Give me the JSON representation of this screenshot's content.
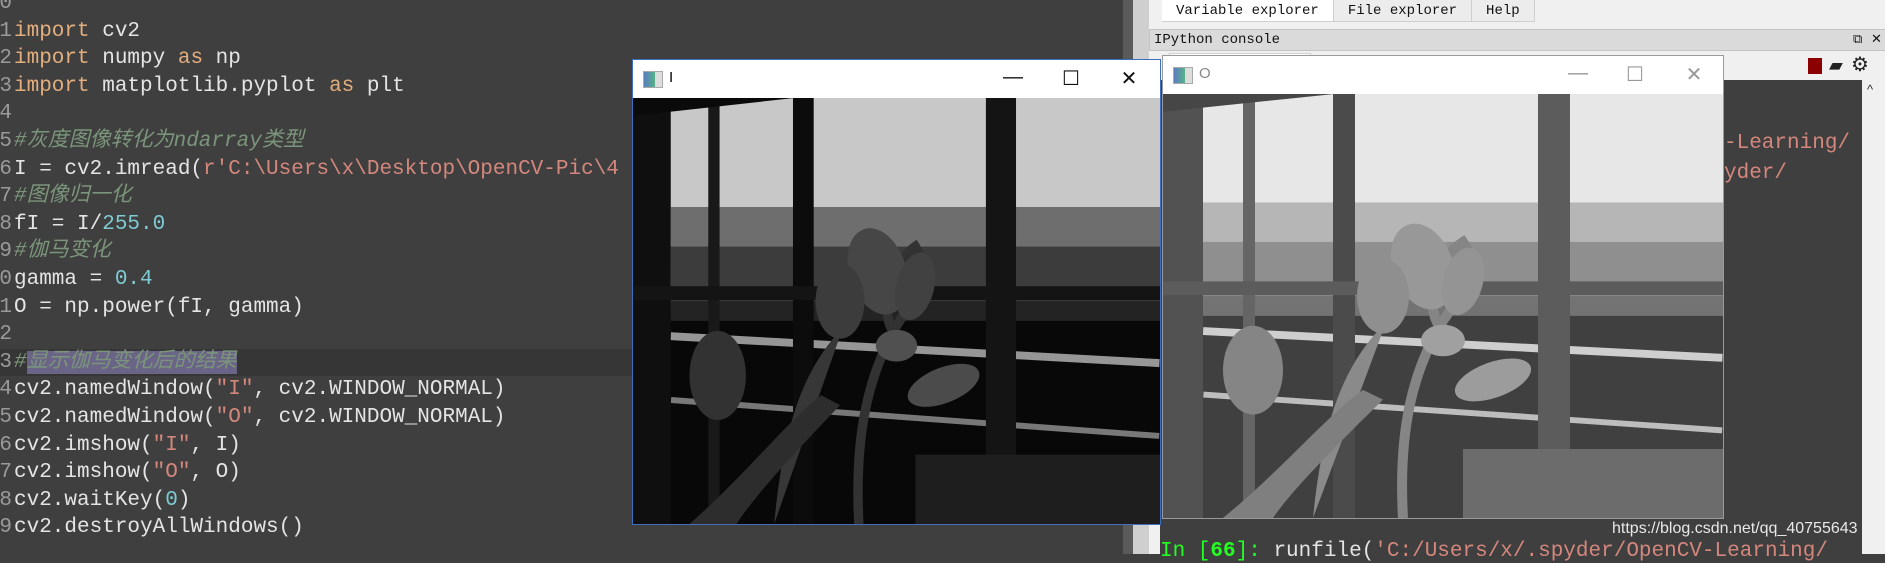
{
  "editor": {
    "current_line": 13,
    "lines": [
      {
        "n": "0",
        "tokens": []
      },
      {
        "n": "1",
        "tokens": [
          {
            "c": "kw",
            "v": "import"
          },
          {
            "c": "nm",
            "v": " cv2"
          }
        ]
      },
      {
        "n": "2",
        "tokens": [
          {
            "c": "kw",
            "v": "import"
          },
          {
            "c": "nm",
            "v": " numpy "
          },
          {
            "c": "kw",
            "v": "as"
          },
          {
            "c": "nm",
            "v": " np"
          }
        ]
      },
      {
        "n": "3",
        "tokens": [
          {
            "c": "kw",
            "v": "import"
          },
          {
            "c": "nm",
            "v": " matplotlib.pyplot "
          },
          {
            "c": "kw",
            "v": "as"
          },
          {
            "c": "nm",
            "v": " plt"
          }
        ]
      },
      {
        "n": "4",
        "tokens": []
      },
      {
        "n": "5",
        "tokens": [
          {
            "c": "cm",
            "v": "#灰度图像转化为ndarray类型"
          }
        ]
      },
      {
        "n": "6",
        "tokens": [
          {
            "c": "nm",
            "v": "I = cv2.imread("
          },
          {
            "c": "str",
            "v": "r'C:\\Users\\x\\Desktop\\OpenCV-Pic\\4"
          }
        ]
      },
      {
        "n": "7",
        "tokens": [
          {
            "c": "cm",
            "v": "#图像归一化"
          }
        ]
      },
      {
        "n": "8",
        "tokens": [
          {
            "c": "nm",
            "v": "fI = I/"
          },
          {
            "c": "num",
            "v": "255.0"
          }
        ]
      },
      {
        "n": "9",
        "tokens": [
          {
            "c": "cm",
            "v": "#伽马变化"
          }
        ]
      },
      {
        "n": "0",
        "tokens": [
          {
            "c": "nm",
            "v": "gamma = "
          },
          {
            "c": "num",
            "v": "0.4"
          }
        ]
      },
      {
        "n": "1",
        "tokens": [
          {
            "c": "nm",
            "v": "O = np.power(fI, gamma)"
          }
        ]
      },
      {
        "n": "2",
        "tokens": []
      },
      {
        "n": "3",
        "tokens": [
          {
            "c": "cm",
            "v": "#"
          },
          {
            "c": "cm sel",
            "v": "显示伽马变化后的结果"
          }
        ]
      },
      {
        "n": "4",
        "tokens": [
          {
            "c": "nm",
            "v": "cv2.namedWindow("
          },
          {
            "c": "str",
            "v": "\"I\""
          },
          {
            "c": "nm",
            "v": ", cv2.WINDOW_NORMAL)"
          }
        ]
      },
      {
        "n": "5",
        "tokens": [
          {
            "c": "nm",
            "v": "cv2.namedWindow("
          },
          {
            "c": "str",
            "v": "\"O\""
          },
          {
            "c": "nm",
            "v": ", cv2.WINDOW_NORMAL)"
          }
        ]
      },
      {
        "n": "6",
        "tokens": [
          {
            "c": "nm",
            "v": "cv2.imshow("
          },
          {
            "c": "str",
            "v": "\"I\""
          },
          {
            "c": "nm",
            "v": ", I)"
          }
        ]
      },
      {
        "n": "7",
        "tokens": [
          {
            "c": "nm",
            "v": "cv2.imshow("
          },
          {
            "c": "str",
            "v": "\"O\""
          },
          {
            "c": "nm",
            "v": ", O)"
          }
        ]
      },
      {
        "n": "8",
        "tokens": [
          {
            "c": "nm",
            "v": "cv2.waitKey("
          },
          {
            "c": "num",
            "v": "0"
          },
          {
            "c": "nm",
            "v": ")"
          }
        ]
      },
      {
        "n": "9",
        "tokens": [
          {
            "c": "nm",
            "v": "cv2.destroyAllWindows()"
          }
        ]
      }
    ]
  },
  "right_pane": {
    "tabs": [
      {
        "label": "Variable explorer",
        "active": true
      },
      {
        "label": "File explorer",
        "active": false
      },
      {
        "label": "Help",
        "active": false
      }
    ],
    "console_header": "IPython console",
    "header_icons": [
      "restore-icon",
      "close-icon"
    ],
    "toolbar_icons": [
      "stop-icon",
      "eraser-icon",
      "gear-icon"
    ],
    "stop_color": "#8b0000",
    "console_lines": [
      {
        "tokens": [
          {
            "c": "str",
            "v": "-Learning/"
          }
        ]
      },
      {
        "tokens": [
          {
            "c": "str",
            "v": "yder/"
          }
        ]
      }
    ],
    "prompt": {
      "in": "In [",
      "num": "66",
      "close": "]: ",
      "cmd": "runfile(",
      "arg": "'C:/Users/x/.spyder/OpenCV-Learning/"
    }
  },
  "windows": [
    {
      "title": "I",
      "active": true,
      "gamma_display": "original"
    },
    {
      "title": "O",
      "active": false,
      "gamma_display": "gamma 0.4"
    }
  ],
  "window_buttons": {
    "minimize": "—",
    "maximize": "☐",
    "close": "✕"
  },
  "watermark": "https://blog.csdn.net/qq_40755643"
}
